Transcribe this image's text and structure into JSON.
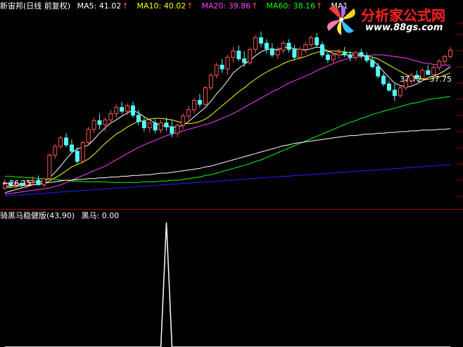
{
  "main_header": {
    "stock_name": "新宙邦(日线 前复权)",
    "indicators": [
      {
        "label": "MA5: 41.02",
        "color": "#ffffff"
      },
      {
        "label": "MA10: 40.02",
        "color": "#ffff00"
      },
      {
        "label": "MA20: 39.86",
        "color": "#ff40ff"
      },
      {
        "label": "MA60: 38.16",
        "color": "#00ff00"
      },
      {
        "label": "MA1",
        "color": "#ffffff"
      }
    ]
  },
  "sub_header": {
    "title": "骑黑马稳健版(43,90)",
    "value_label": "黑马: 0.00"
  },
  "annotations": {
    "low": "←26.15",
    "high": "37.72 - 37.75"
  },
  "watermark": {
    "title": "分析家公式网",
    "url": "www.88gs.com"
  },
  "colors": {
    "background": "#000000",
    "up_candle": "#ff5555",
    "down_candle": "#54ffff",
    "ma5": "#ffffff",
    "ma10": "#ffff00",
    "ma20": "#ff40ff",
    "ma60": "#00ff00",
    "ma120": "#ffffff",
    "ma250": "#2020ff",
    "divider": "#a00000",
    "grid": "#a00000"
  },
  "chart_data": [
    {
      "type": "candlestick",
      "title": "新宙邦(日线 前复权)",
      "price_range": [
        24,
        49
      ],
      "marked_low": 26.15,
      "marked_high_range": [
        37.72,
        37.75
      ],
      "candles": [
        [
          26.6,
          27.8,
          26.3,
          27.3
        ],
        [
          27.3,
          27.6,
          26.6,
          26.9
        ],
        [
          26.9,
          27.4,
          26.3,
          27.2
        ],
        [
          27.2,
          27.6,
          26.7,
          27.0
        ],
        [
          27.0,
          27.7,
          26.6,
          27.5
        ],
        [
          27.5,
          28.1,
          27.0,
          27.6
        ],
        [
          27.6,
          28.2,
          27.1,
          27.0
        ],
        [
          27.0,
          27.9,
          26.7,
          27.8
        ],
        [
          27.8,
          31.0,
          27.5,
          30.8
        ],
        [
          30.8,
          32.2,
          30.3,
          31.9
        ],
        [
          31.9,
          33.3,
          31.6,
          33.0
        ],
        [
          33.0,
          33.6,
          31.8,
          32.1
        ],
        [
          32.1,
          32.8,
          31.1,
          31.3
        ],
        [
          31.3,
          31.8,
          29.6,
          30.0
        ],
        [
          30.0,
          32.6,
          29.8,
          32.4
        ],
        [
          32.4,
          34.4,
          32.1,
          34.1
        ],
        [
          34.1,
          35.6,
          33.6,
          35.2
        ],
        [
          35.2,
          36.1,
          34.1,
          34.7
        ],
        [
          34.7,
          35.6,
          33.8,
          35.3
        ],
        [
          35.3,
          36.6,
          34.9,
          36.1
        ],
        [
          36.1,
          37.3,
          35.6,
          36.9
        ],
        [
          36.9,
          37.6,
          36.1,
          36.4
        ],
        [
          36.4,
          37.4,
          35.9,
          37.1
        ],
        [
          37.1,
          37.6,
          35.6,
          35.9
        ],
        [
          35.9,
          36.6,
          34.6,
          35.1
        ],
        [
          35.1,
          35.6,
          33.8,
          34.3
        ],
        [
          34.3,
          35.1,
          33.6,
          34.9
        ],
        [
          34.9,
          35.4,
          33.6,
          34.0
        ],
        [
          34.0,
          35.3,
          33.6,
          34.9
        ],
        [
          34.9,
          35.6,
          33.9,
          34.4
        ],
        [
          34.4,
          35.3,
          33.1,
          33.6
        ],
        [
          33.6,
          34.8,
          33.1,
          34.6
        ],
        [
          34.6,
          36.1,
          34.1,
          35.8
        ],
        [
          35.8,
          37.1,
          35.3,
          36.6
        ],
        [
          36.6,
          38.1,
          36.1,
          37.8
        ],
        [
          37.8,
          38.6,
          36.9,
          37.3
        ],
        [
          37.3,
          39.6,
          37.1,
          39.4
        ],
        [
          39.4,
          41.3,
          39.1,
          41.0
        ],
        [
          41.0,
          42.6,
          40.6,
          42.3
        ],
        [
          42.3,
          43.1,
          41.3,
          41.8
        ],
        [
          41.8,
          43.6,
          41.1,
          43.3
        ],
        [
          43.3,
          44.6,
          42.6,
          44.1
        ],
        [
          44.1,
          44.8,
          42.8,
          43.1
        ],
        [
          43.1,
          44.1,
          42.1,
          42.6
        ],
        [
          42.6,
          44.6,
          42.3,
          44.3
        ],
        [
          44.3,
          46.1,
          43.8,
          45.8
        ],
        [
          45.8,
          46.6,
          44.6,
          45.1
        ],
        [
          45.1,
          45.6,
          43.8,
          44.4
        ],
        [
          44.4,
          45.1,
          43.3,
          43.6
        ],
        [
          43.6,
          44.6,
          43.1,
          44.2
        ],
        [
          44.2,
          45.4,
          43.8,
          45.1
        ],
        [
          45.1,
          45.6,
          43.9,
          44.3
        ],
        [
          44.3,
          44.9,
          42.9,
          43.3
        ],
        [
          43.3,
          44.6,
          43.1,
          44.3
        ],
        [
          44.3,
          45.3,
          43.8,
          44.9
        ],
        [
          44.9,
          46.1,
          44.6,
          45.8
        ],
        [
          45.8,
          46.4,
          44.6,
          44.9
        ],
        [
          44.9,
          45.3,
          43.3,
          43.6
        ],
        [
          43.6,
          44.1,
          42.6,
          43.0
        ],
        [
          43.0,
          43.8,
          42.6,
          43.6
        ],
        [
          43.6,
          44.4,
          43.1,
          43.9
        ],
        [
          43.9,
          44.6,
          43.3,
          43.6
        ],
        [
          43.6,
          44.1,
          42.8,
          43.3
        ],
        [
          43.3,
          44.1,
          42.9,
          43.9
        ],
        [
          43.9,
          44.4,
          43.1,
          43.5
        ],
        [
          43.5,
          43.9,
          42.6,
          42.9
        ],
        [
          42.9,
          43.4,
          41.9,
          42.1
        ],
        [
          42.1,
          42.6,
          40.6,
          40.9
        ],
        [
          40.9,
          41.3,
          39.6,
          39.9
        ],
        [
          39.9,
          40.3,
          38.9,
          39.1
        ],
        [
          39.1,
          39.9,
          37.7,
          38.4
        ],
        [
          38.4,
          39.6,
          38.1,
          39.4
        ],
        [
          39.4,
          40.6,
          39.1,
          40.3
        ],
        [
          40.3,
          41.3,
          39.9,
          41.0
        ],
        [
          41.0,
          41.6,
          40.3,
          40.6
        ],
        [
          40.6,
          41.9,
          40.3,
          41.6
        ],
        [
          41.6,
          42.3,
          41.1,
          41.1
        ],
        [
          41.1,
          42.3,
          40.9,
          42.0
        ],
        [
          42.0,
          43.1,
          41.6,
          42.8
        ],
        [
          42.8,
          43.6,
          42.4,
          43.4
        ],
        [
          43.4,
          44.6,
          43.1,
          44.2
        ]
      ],
      "series": [
        {
          "name": "MA5",
          "values": [
            26.8,
            26.9,
            27.0,
            27.1,
            27.2,
            27.3,
            27.4,
            27.4,
            27.9,
            28.6,
            29.4,
            30.3,
            31.1,
            31.6,
            31.8,
            32.1,
            32.8,
            33.6,
            34.3,
            34.9,
            35.3,
            35.8,
            36.2,
            36.5,
            36.2,
            35.7,
            35.3,
            34.9,
            34.6,
            34.5,
            34.4,
            34.4,
            34.6,
            35.1,
            35.7,
            36.3,
            36.9,
            37.7,
            38.6,
            39.4,
            40.3,
            41.3,
            41.9,
            42.4,
            42.9,
            43.5,
            44.0,
            44.3,
            44.3,
            44.3,
            44.5,
            44.6,
            44.4,
            44.3,
            44.2,
            44.4,
            44.6,
            44.5,
            44.1,
            43.8,
            43.6,
            43.6,
            43.6,
            43.6,
            43.5,
            43.3,
            42.9,
            42.3,
            41.5,
            40.7,
            40.0,
            39.7,
            39.5,
            39.6,
            39.9,
            40.3,
            40.7,
            40.9,
            41.2,
            41.6,
            42.1
          ]
        },
        {
          "name": "MA10",
          "values": [
            26.6,
            26.7,
            26.8,
            26.9,
            27.0,
            27.0,
            27.1,
            27.2,
            27.5,
            27.9,
            28.3,
            28.8,
            29.3,
            29.6,
            29.9,
            30.3,
            30.9,
            31.6,
            32.3,
            32.9,
            33.5,
            33.9,
            34.4,
            34.8,
            35.1,
            35.2,
            35.4,
            35.5,
            35.5,
            35.4,
            35.3,
            35.1,
            34.9,
            34.8,
            34.9,
            35.1,
            35.4,
            35.9,
            36.5,
            37.1,
            37.7,
            38.3,
            38.9,
            39.4,
            40.0,
            40.5,
            41.0,
            41.4,
            41.8,
            42.1,
            42.5,
            42.8,
            43.0,
            43.2,
            43.4,
            43.7,
            43.9,
            44.1,
            44.1,
            44.1,
            44.1,
            44.0,
            43.9,
            43.8,
            43.6,
            43.5,
            43.3,
            43.1,
            42.7,
            42.3,
            41.9,
            41.5,
            41.1,
            40.8,
            40.6,
            40.5,
            40.5,
            40.6,
            40.8,
            41.0,
            41.3
          ]
        },
        {
          "name": "MA20",
          "values": [
            25.8,
            25.9,
            26.0,
            26.1,
            26.2,
            26.3,
            26.4,
            26.5,
            26.6,
            26.8,
            27.0,
            27.3,
            27.6,
            27.9,
            28.2,
            28.5,
            28.8,
            29.1,
            29.4,
            29.8,
            30.2,
            30.6,
            31.0,
            31.4,
            31.8,
            32.1,
            32.4,
            32.7,
            33.0,
            33.3,
            33.5,
            33.7,
            33.9,
            34.1,
            34.3,
            34.5,
            34.7,
            34.9,
            35.2,
            35.5,
            35.8,
            36.1,
            36.5,
            36.9,
            37.3,
            37.7,
            38.1,
            38.5,
            38.9,
            39.2,
            39.6,
            40.0,
            40.3,
            40.6,
            40.9,
            41.2,
            41.6,
            41.9,
            42.2,
            42.5,
            42.8,
            43.0,
            43.2,
            43.3,
            43.4,
            43.5,
            43.6,
            43.6,
            43.6,
            43.5,
            43.4,
            43.3,
            43.2,
            43.0,
            42.8,
            42.6,
            42.5,
            42.4,
            42.3,
            42.3,
            42.3
          ]
        },
        {
          "name": "MA60",
          "values": [
            28.1,
            28.1,
            28.0,
            28.0,
            27.9,
            27.9,
            27.8,
            27.8,
            27.7,
            27.7,
            27.6,
            27.6,
            27.5,
            27.5,
            27.4,
            27.4,
            27.4,
            27.4,
            27.4,
            27.3,
            27.3,
            27.3,
            27.3,
            27.3,
            27.3,
            27.4,
            27.4,
            27.4,
            27.5,
            27.5,
            27.6,
            27.6,
            27.7,
            27.8,
            27.9,
            28.0,
            28.2,
            28.3,
            28.5,
            28.7,
            28.9,
            29.1,
            29.3,
            29.5,
            29.7,
            30.0,
            30.2,
            30.5,
            30.8,
            31.1,
            31.4,
            31.7,
            32.0,
            32.3,
            32.6,
            32.9,
            33.2,
            33.5,
            33.8,
            34.1,
            34.4,
            34.7,
            35.0,
            35.2,
            35.5,
            35.7,
            36.0,
            36.2,
            36.4,
            36.6,
            36.8,
            37.0,
            37.2,
            37.4,
            37.5,
            37.7,
            37.9,
            38.0,
            38.1,
            38.2,
            38.3
          ]
        },
        {
          "name": "MA120",
          "values": [
            26.0,
            26.2,
            26.4,
            26.6,
            26.8,
            27.0,
            27.1,
            27.2,
            27.3,
            27.4,
            27.5,
            27.6,
            27.6,
            27.7,
            27.7,
            27.8,
            27.8,
            27.9,
            27.9,
            28.0,
            28.0,
            28.1,
            28.1,
            28.2,
            28.2,
            28.3,
            28.3,
            28.4,
            28.5,
            28.5,
            28.6,
            28.7,
            28.8,
            28.9,
            29.0,
            29.1,
            29.3,
            29.4,
            29.6,
            29.8,
            30.0,
            30.2,
            30.4,
            30.6,
            30.8,
            31.0,
            31.2,
            31.4,
            31.6,
            31.8,
            32.0,
            32.1,
            32.3,
            32.4,
            32.5,
            32.6,
            32.7,
            32.8,
            32.9,
            33.0,
            33.1,
            33.2,
            33.3,
            33.3,
            33.4,
            33.5,
            33.5,
            33.6,
            33.6,
            33.7,
            33.7,
            33.8,
            33.8,
            33.9,
            33.9,
            34.0,
            34.0,
            34.0,
            34.1,
            34.1,
            34.2
          ]
        },
        {
          "name": "MA250",
          "values": [
            25.6,
            25.6,
            25.7,
            25.7,
            25.8,
            25.8,
            25.9,
            25.9,
            26.0,
            26.0,
            26.1,
            26.1,
            26.2,
            26.2,
            26.3,
            26.3,
            26.4,
            26.4,
            26.5,
            26.5,
            26.6,
            26.6,
            26.7,
            26.7,
            26.8,
            26.8,
            26.9,
            26.9,
            27.0,
            27.0,
            27.1,
            27.1,
            27.2,
            27.2,
            27.3,
            27.3,
            27.4,
            27.4,
            27.5,
            27.5,
            27.6,
            27.6,
            27.7,
            27.7,
            27.8,
            27.8,
            27.9,
            27.9,
            28.0,
            28.0,
            28.1,
            28.1,
            28.2,
            28.2,
            28.3,
            28.3,
            28.4,
            28.4,
            28.5,
            28.5,
            28.6,
            28.6,
            28.7,
            28.7,
            28.8,
            28.8,
            28.9,
            28.9,
            29.0,
            29.0,
            29.1,
            29.1,
            29.2,
            29.2,
            29.3,
            29.3,
            29.4,
            29.4,
            29.5,
            29.5,
            29.6
          ]
        }
      ]
    },
    {
      "type": "line",
      "title": "骑黑马稳健版(43,90)",
      "series": [
        {
          "name": "黑马",
          "values": [
            0,
            0,
            0,
            0,
            0,
            0,
            0,
            0,
            0,
            0,
            0,
            0,
            0,
            0,
            0,
            0,
            0,
            0,
            0,
            0,
            0,
            0,
            0,
            0,
            0,
            0,
            0,
            0,
            0,
            0,
            0,
            0,
            0,
            0,
            0,
            0,
            0,
            0,
            0,
            0,
            0,
            0,
            0,
            0,
            0,
            0,
            0,
            0,
            0,
            0,
            0,
            0,
            0,
            0,
            0,
            0,
            0,
            0,
            0,
            0,
            0,
            0,
            0,
            0,
            0,
            0,
            0,
            0,
            0,
            0,
            0,
            0,
            0,
            0,
            0,
            0,
            0,
            0,
            0,
            0,
            0
          ]
        }
      ],
      "spike": {
        "index": 29,
        "value": 100
      },
      "ylim": [
        0,
        100
      ]
    }
  ]
}
